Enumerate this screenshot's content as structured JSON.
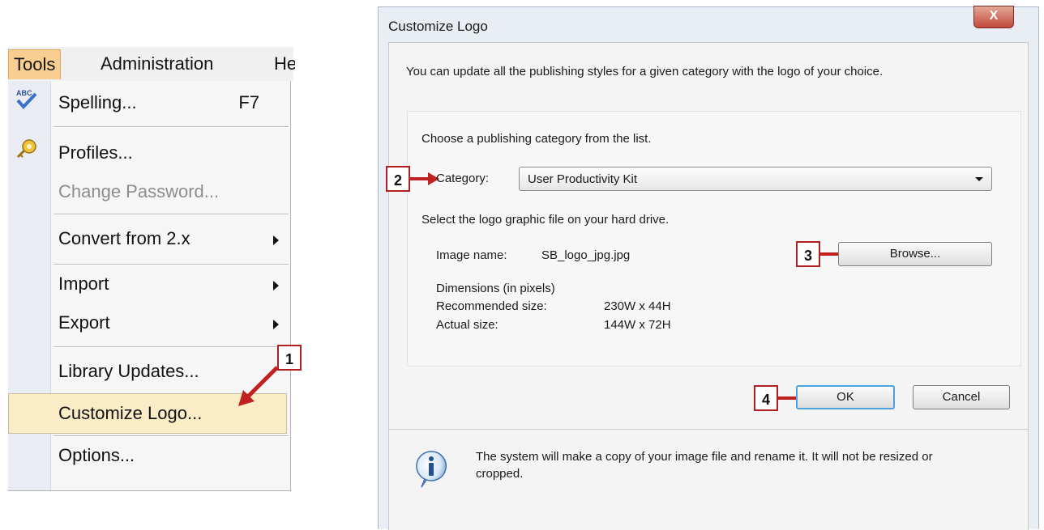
{
  "menubar": {
    "tools": "Tools",
    "administration": "Administration",
    "help": "He"
  },
  "tools_menu": {
    "items": [
      {
        "label": "Spelling...",
        "shortcut": "F7"
      },
      {
        "label": "Profiles..."
      },
      {
        "label": "Change Password...",
        "disabled": true
      },
      {
        "label": "Convert from 2.x",
        "submenu": true
      },
      {
        "label": "Import",
        "submenu": true
      },
      {
        "label": "Export",
        "submenu": true
      },
      {
        "label": "Library Updates..."
      },
      {
        "label": "Customize Logo...",
        "highlighted": true
      },
      {
        "label": "Options..."
      }
    ]
  },
  "callouts": [
    "1",
    "2",
    "3",
    "4"
  ],
  "dialog": {
    "title": "Customize Logo",
    "close_label": "X",
    "intro": "You can update all the publishing styles for a given category with the logo of your choice.",
    "choose_text": "Choose a publishing category from the list.",
    "category_label": "Category:",
    "category_value": "User Productivity Kit",
    "select_text": "Select the logo graphic file on your hard drive.",
    "image_name_label": "Image name:",
    "image_name_value": "SB_logo_jpg.jpg",
    "browse_label": "Browse...",
    "dimensions_label": "Dimensions (in pixels)",
    "recommended_label": "Recommended size:",
    "recommended_value": "230W x 44H",
    "actual_label": "Actual size:",
    "actual_value": "144W x 72H",
    "ok_label": "OK",
    "cancel_label": "Cancel",
    "info_text_line1": "The system will make a copy of your image file and rename it. It will not be resized or",
    "info_text_line2": "cropped."
  },
  "colors": {
    "callout_border": "#b02022",
    "arrow": "#c0201f",
    "menu_highlight": "#faedc5",
    "tools_active": "#f8ce91"
  }
}
